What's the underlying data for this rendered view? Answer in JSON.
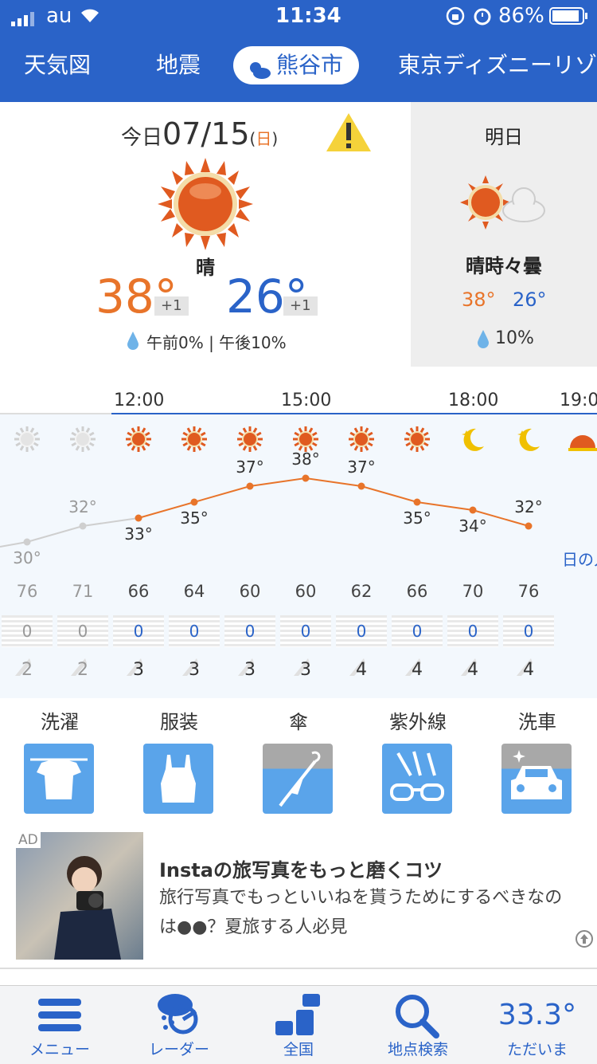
{
  "status": {
    "carrier": "au",
    "time": "11:34",
    "battery": "86%"
  },
  "tabs": [
    {
      "label": "天気図"
    },
    {
      "label": "地震"
    },
    {
      "label": "熊谷市"
    },
    {
      "label": "東京ディズニーリゾ"
    }
  ],
  "today": {
    "label": "今日",
    "date": "07/15",
    "weekday_open": "(",
    "weekday": "日",
    "weekday_close": ")",
    "condition": "晴",
    "high": "38°",
    "high_diff": "+1",
    "low": "26°",
    "low_diff": "+1",
    "rain": "午前0% | 午後10%"
  },
  "tomorrow": {
    "label": "明日",
    "condition": "晴時々曇",
    "high": "38°",
    "low": "26°",
    "rain": "10%"
  },
  "timeline": {
    "hour_labels": [
      "12:00",
      "15:00",
      "18:00",
      "19:0"
    ],
    "sunset_label": "日の入",
    "temps": [
      "30°",
      "32°",
      "33°",
      "35°",
      "37°",
      "38°",
      "37°",
      "35°",
      "34°",
      "32°"
    ],
    "temp_values": [
      30,
      32,
      33,
      35,
      37,
      38,
      37,
      35,
      34,
      32
    ],
    "humidity": [
      "76",
      "71",
      "66",
      "64",
      "60",
      "60",
      "62",
      "66",
      "70",
      "76"
    ],
    "rain": [
      "0",
      "0",
      "0",
      "0",
      "0",
      "0",
      "0",
      "0",
      "0",
      "0"
    ],
    "wind": [
      "2",
      "2",
      "3",
      "3",
      "3",
      "3",
      "4",
      "4",
      "4",
      "4"
    ],
    "icons": [
      "sun-gray",
      "sun-gray",
      "sun",
      "sun",
      "sun",
      "sun",
      "sun",
      "sun",
      "moon",
      "moon"
    ]
  },
  "life": [
    {
      "label": "洗濯",
      "icon": "laundry-icon"
    },
    {
      "label": "服装",
      "icon": "clothing-icon"
    },
    {
      "label": "傘",
      "icon": "umbrella-icon"
    },
    {
      "label": "紫外線",
      "icon": "uv-icon"
    },
    {
      "label": "洗車",
      "icon": "car-wash-icon"
    }
  ],
  "ad": {
    "badge": "AD",
    "title": "Instaの旅写真をもっと磨くコツ",
    "body": "旅行写真でもっといいねを貰うためにするべきなのは●●？夏旅する人必見"
  },
  "bottomnav": [
    {
      "label": "メニュー",
      "icon": "menu-icon"
    },
    {
      "label": "レーダー",
      "icon": "radar-icon"
    },
    {
      "label": "全国",
      "icon": "national-icon"
    },
    {
      "label": "地点検索",
      "icon": "search-icon"
    },
    {
      "label": "ただいま",
      "value": "33.3°"
    }
  ],
  "colors": {
    "primary": "#2a63c8",
    "orange": "#e8742a",
    "sunny": "#e05a20"
  }
}
